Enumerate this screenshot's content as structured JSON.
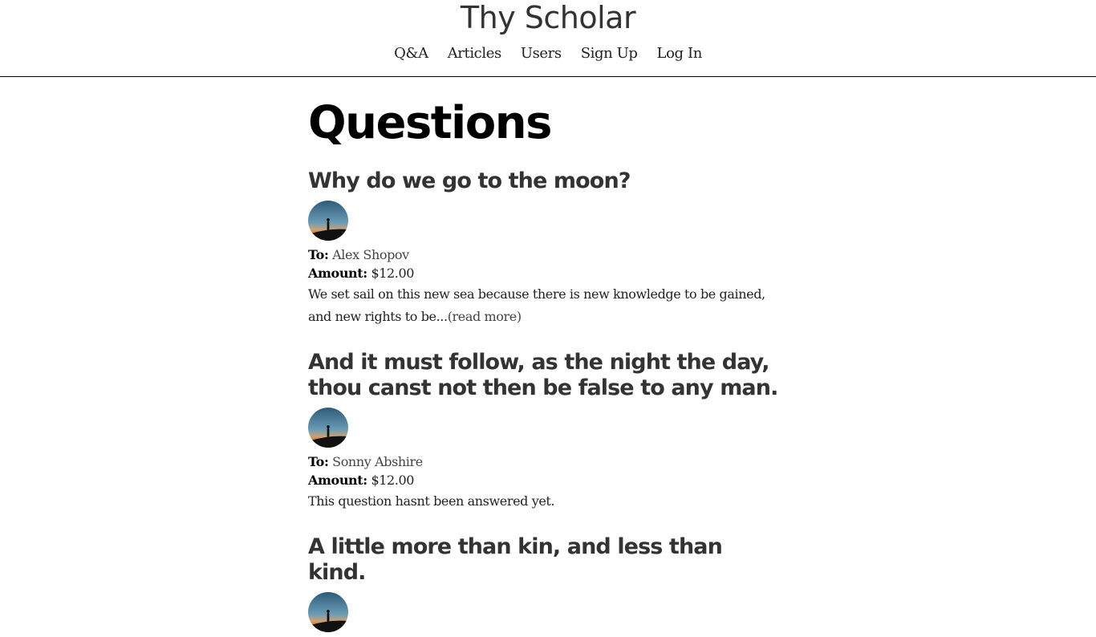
{
  "site": {
    "title": "Thy Scholar"
  },
  "nav": {
    "items": [
      "Q&A",
      "Articles",
      "Users",
      "Sign Up",
      "Log In"
    ]
  },
  "page": {
    "title": "Questions"
  },
  "labels": {
    "to": "To:",
    "amount": "Amount:"
  },
  "questions": [
    {
      "title": "Why do we go to the moon?",
      "to": "Alex Shopov",
      "amount": "$12.00",
      "excerpt": "We set sail on this new sea because there is new knowledge to be gained, and new rights to be...",
      "read_more": "(read more)"
    },
    {
      "title": "And it must follow, as the night the day, thou canst not then be false to any man.",
      "to": "Sonny Abshire",
      "amount": "$12.00",
      "excerpt": "This question hasnt been answered yet.",
      "read_more": ""
    },
    {
      "title": "A little more than kin, and less than kind.",
      "to": "",
      "amount": "",
      "excerpt": "",
      "read_more": ""
    }
  ]
}
